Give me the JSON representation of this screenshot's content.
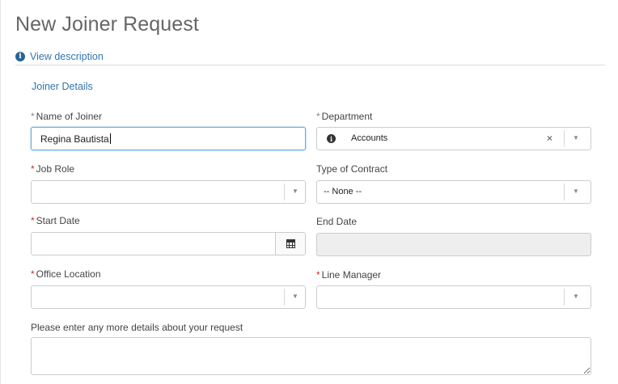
{
  "page": {
    "title": "New Joiner Request"
  },
  "view_description": {
    "label": "View description",
    "icon": "info-icon"
  },
  "section": {
    "title": "Joiner Details"
  },
  "fields": {
    "name_of_joiner": {
      "label": "Name of Joiner",
      "required": true,
      "value": "Regina Bautista"
    },
    "department": {
      "label": "Department",
      "required": true,
      "value": "Accounts"
    },
    "job_role": {
      "label": "Job Role",
      "required": true,
      "value": ""
    },
    "type_of_contract": {
      "label": "Type of Contract",
      "required": false,
      "value": "-- None --"
    },
    "start_date": {
      "label": "Start Date",
      "required": true,
      "value": ""
    },
    "end_date": {
      "label": "End Date",
      "required": false,
      "value": ""
    },
    "office_location": {
      "label": "Office Location",
      "required": true,
      "value": ""
    },
    "line_manager": {
      "label": "Line Manager",
      "required": true,
      "value": ""
    },
    "more_details": {
      "label": "Please enter any more details about your request",
      "value": ""
    }
  },
  "symbols": {
    "required_mark": "*",
    "clear": "×",
    "dropdown": "▼",
    "info": "i"
  },
  "colors": {
    "link": "#3275ad",
    "required_red": "#c9302c",
    "required_grey": "#888888",
    "focus_border": "#6aa8dd"
  }
}
